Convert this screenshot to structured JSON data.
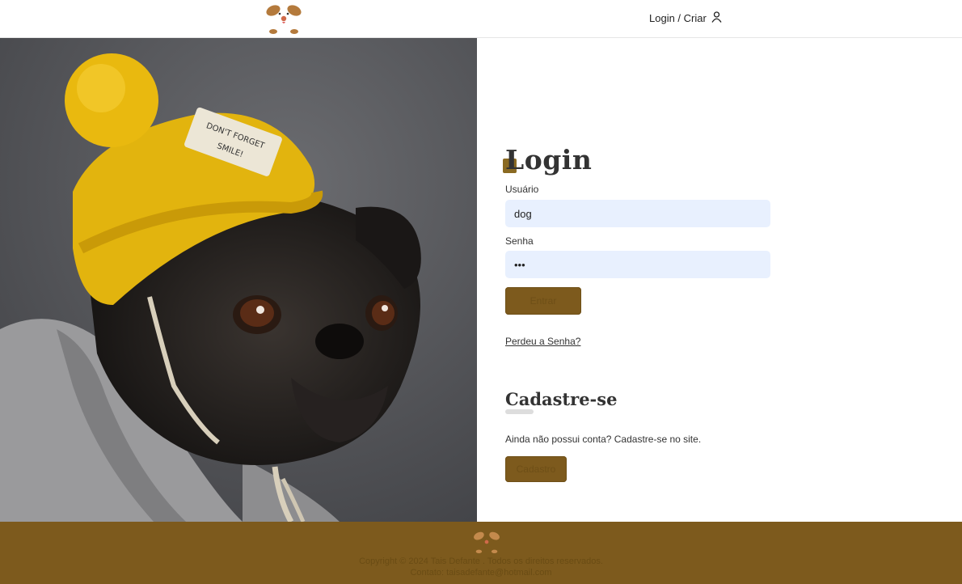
{
  "header": {
    "login_label": "Login / Criar",
    "logo_icon": "dog-face-logo-icon",
    "user_icon": "user-icon"
  },
  "photo": {
    "description_icon": "pug-with-yellow-beanie-photo",
    "hat_patch_text_line1": "DON'T FORGET",
    "hat_patch_text_line2": "SMILE!"
  },
  "login": {
    "title": "Login",
    "username_label": "Usuário",
    "username_value": "dog",
    "password_label": "Senha",
    "password_value": "•••",
    "submit_label": "Entrar",
    "lost_password_label": "Perdeu a Senha?"
  },
  "signup": {
    "title": "Cadastre-se",
    "text": "Ainda não possui conta? Cadastre-se no site.",
    "button_label": "Cadastro"
  },
  "footer": {
    "copyright": "Copyright © 2024 Tais Defante . Todos os direitos reservados.",
    "contact": "Contato: taisadefante@hotmail.com"
  },
  "colors": {
    "brand_brown": "#7d5a1d",
    "input_bg": "#e8f0fe",
    "accent_orange": "#c47a34"
  }
}
